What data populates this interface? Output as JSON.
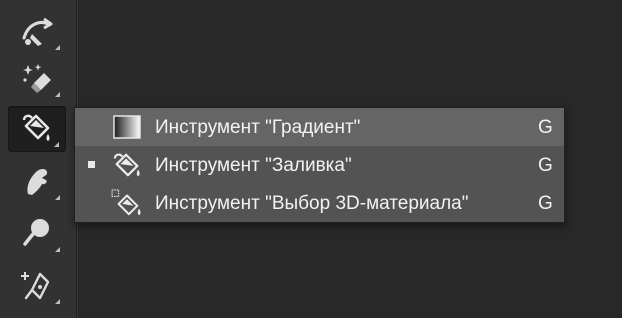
{
  "toolbar": {
    "tools": [
      {
        "icon": "healing-brush-icon"
      },
      {
        "icon": "magic-eraser-icon"
      },
      {
        "icon": "paint-bucket-icon",
        "active": true
      },
      {
        "icon": "smudge-finger-icon"
      },
      {
        "icon": "dodge-icon"
      },
      {
        "icon": "pen-add-icon"
      }
    ]
  },
  "flyout": {
    "items": [
      {
        "icon": "gradient-icon",
        "label": "Инструмент \"Градиент\"",
        "shortcut": "G",
        "highlighted": true,
        "selected": false
      },
      {
        "icon": "paint-bucket-icon",
        "label": "Инструмент \"Заливка\"",
        "shortcut": "G",
        "highlighted": false,
        "selected": true
      },
      {
        "icon": "3d-material-drop-icon",
        "label": "Инструмент \"Выбор 3D-материала\"",
        "shortcut": "G",
        "highlighted": false,
        "selected": false
      }
    ]
  },
  "colors": {
    "background": "#282828",
    "toolbar": "#323232",
    "menu": "#535353",
    "menu_highlight": "#656565",
    "text": "#f2f2f2"
  }
}
